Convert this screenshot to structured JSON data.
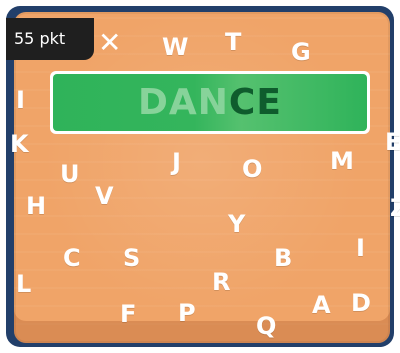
{
  "score": {
    "text": "55 pkt"
  },
  "close": {
    "glyph": "✕"
  },
  "word": {
    "found": "DAN",
    "pending": "CE"
  },
  "letters": [
    {
      "id": "w",
      "ch": "W"
    },
    {
      "id": "t",
      "ch": "T"
    },
    {
      "id": "g",
      "ch": "G"
    },
    {
      "id": "i-left-top",
      "ch": "I"
    },
    {
      "id": "k-left",
      "ch": "K"
    },
    {
      "id": "u",
      "ch": "U"
    },
    {
      "id": "j",
      "ch": "J"
    },
    {
      "id": "o",
      "ch": "O"
    },
    {
      "id": "m",
      "ch": "M"
    },
    {
      "id": "e-right",
      "ch": "E"
    },
    {
      "id": "h",
      "ch": "H"
    },
    {
      "id": "v",
      "ch": "V"
    },
    {
      "id": "y",
      "ch": "Y"
    },
    {
      "id": "z-right",
      "ch": "Z"
    },
    {
      "id": "c",
      "ch": "C"
    },
    {
      "id": "s",
      "ch": "S"
    },
    {
      "id": "b",
      "ch": "B"
    },
    {
      "id": "i-right",
      "ch": "I"
    },
    {
      "id": "l-left",
      "ch": "L"
    },
    {
      "id": "r",
      "ch": "R"
    },
    {
      "id": "f",
      "ch": "F"
    },
    {
      "id": "p",
      "ch": "P"
    },
    {
      "id": "q",
      "ch": "Q"
    },
    {
      "id": "a",
      "ch": "A"
    },
    {
      "id": "d",
      "ch": "D"
    }
  ]
}
